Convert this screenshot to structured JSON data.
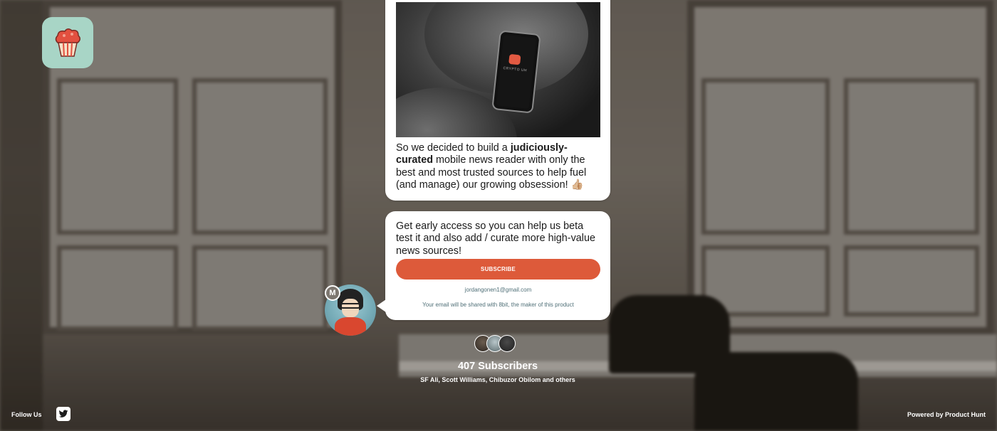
{
  "card_story": {
    "text_before": "So we decided to build a ",
    "text_bold": "judiciously-curated",
    "text_after": " mobile news reader with only the best and most trusted sources to help fuel (and manage) our growing obsession! 👍🏼",
    "photo_app_text": "CRYPTO UH"
  },
  "card_signup": {
    "text": "Get early access so you can help us beta test it and also add / curate more high-value news sources!",
    "subscribe_label": "SUBSCRIBE",
    "email": "jordangonen1@gmail.com",
    "notice": "Your email will be shared with 8bit, the maker of this product"
  },
  "maker": {
    "badge_letter": "M"
  },
  "subscribers": {
    "count_label": "407 Subscribers",
    "names": "SF Ali, Scott Williams, Chibuzor Obilom and others"
  },
  "footer": {
    "follow_label": "Follow Us",
    "powered_label": "Powered by Product Hunt"
  },
  "icons": {
    "logo": "cupcake-logo-icon",
    "twitter": "twitter-icon"
  },
  "colors": {
    "accent": "#dd5a3a",
    "logo_bg": "#a8d5c6",
    "muted_text": "#4f6f77"
  }
}
